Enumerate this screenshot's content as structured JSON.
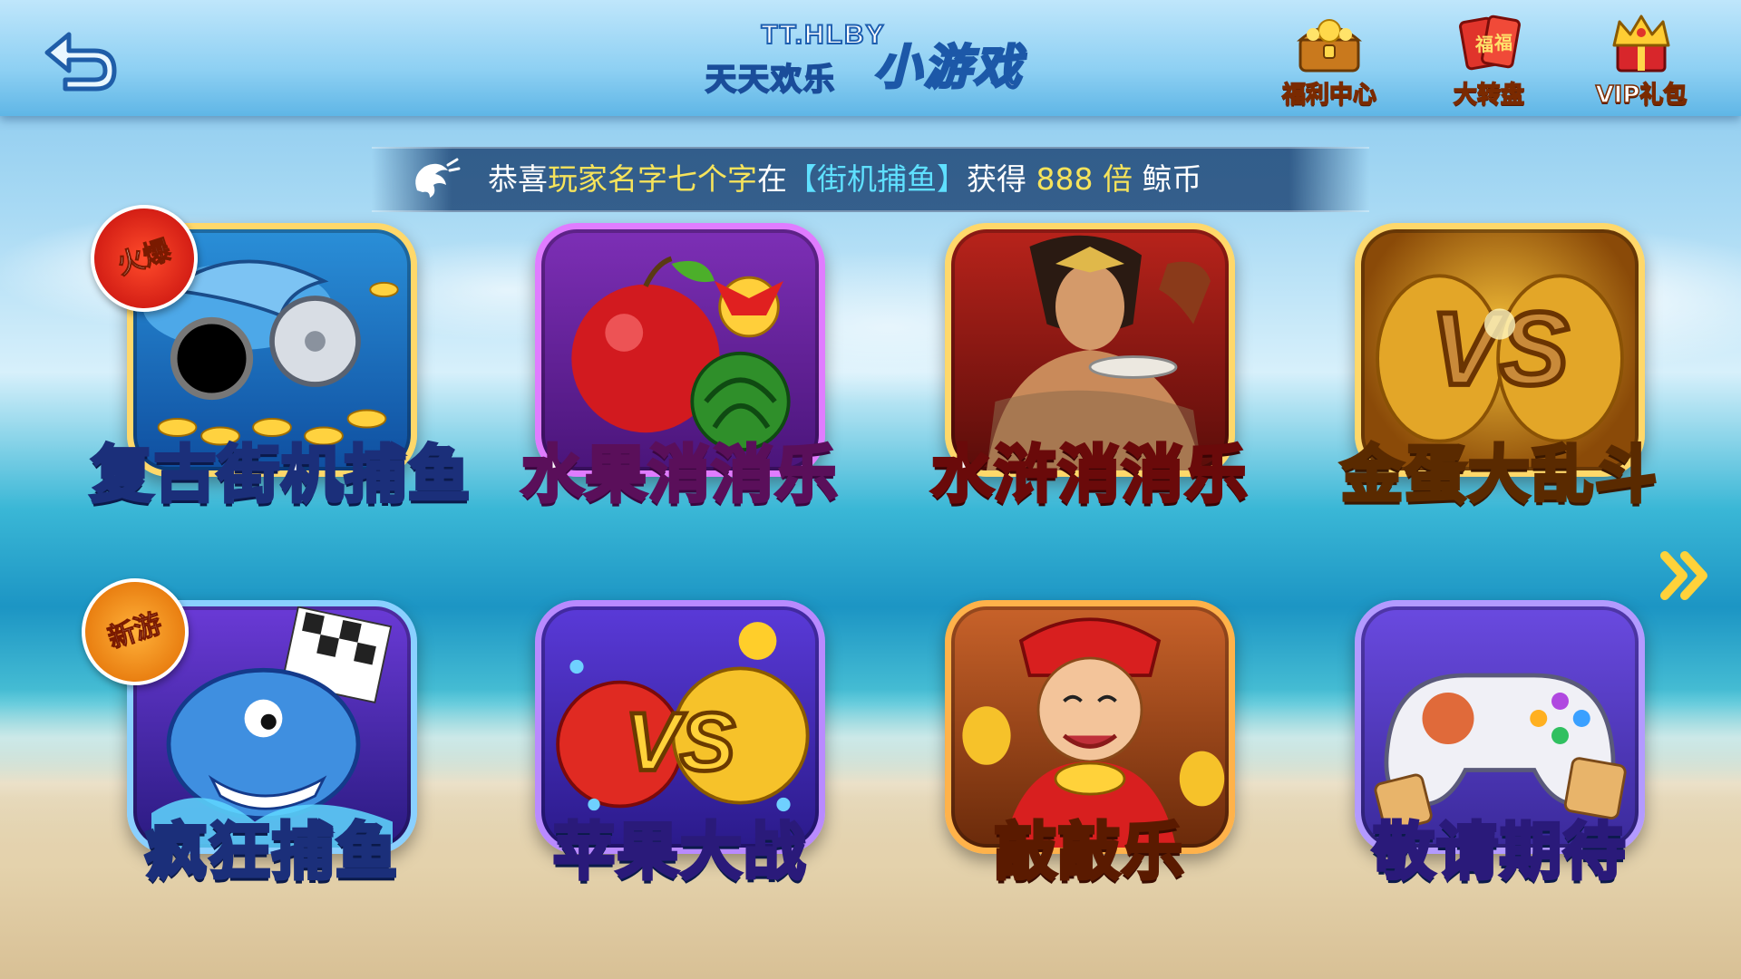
{
  "header": {
    "brand": "TT.HLBY",
    "title_main": "天天欢乐",
    "title_sub": "小游戏",
    "buttons": [
      {
        "label": "福利中心",
        "icon": "treasure-chest-icon"
      },
      {
        "label": "大转盘",
        "icon": "lucky-cards-icon"
      },
      {
        "label": "VIP礼包",
        "icon": "crown-gift-icon"
      }
    ]
  },
  "marquee": {
    "prefix": "恭喜",
    "player": "玩家名字七个字",
    "mid1": "在",
    "game": "【街机捕鱼】",
    "mid2": "获得",
    "amount": "888",
    "unit": "倍",
    "suffix": "鲸币"
  },
  "games": [
    {
      "name": "复古街机捕鱼",
      "badge": "火爆",
      "theme": "shark-cannon"
    },
    {
      "name": "水果消消乐",
      "badge": "",
      "theme": "fruit"
    },
    {
      "name": "水浒消消乐",
      "badge": "",
      "theme": "warrior"
    },
    {
      "name": "金蛋大乱斗",
      "badge": "",
      "theme": "golden-egg-vs"
    },
    {
      "name": "疯狂捕鱼",
      "badge": "新游",
      "theme": "crazy-fish"
    },
    {
      "name": "苹果大战",
      "badge": "",
      "theme": "apple-vs"
    },
    {
      "name": "敲敲乐",
      "badge": "",
      "theme": "fortune-god"
    },
    {
      "name": "敬请期待",
      "badge": "",
      "theme": "gamepad"
    }
  ],
  "colors": {
    "frame": "#ffd86a",
    "title_stroke": "#1b2f7a",
    "marquee_yellow": "#f6e35b",
    "marquee_blue": "#5fe0ff"
  }
}
